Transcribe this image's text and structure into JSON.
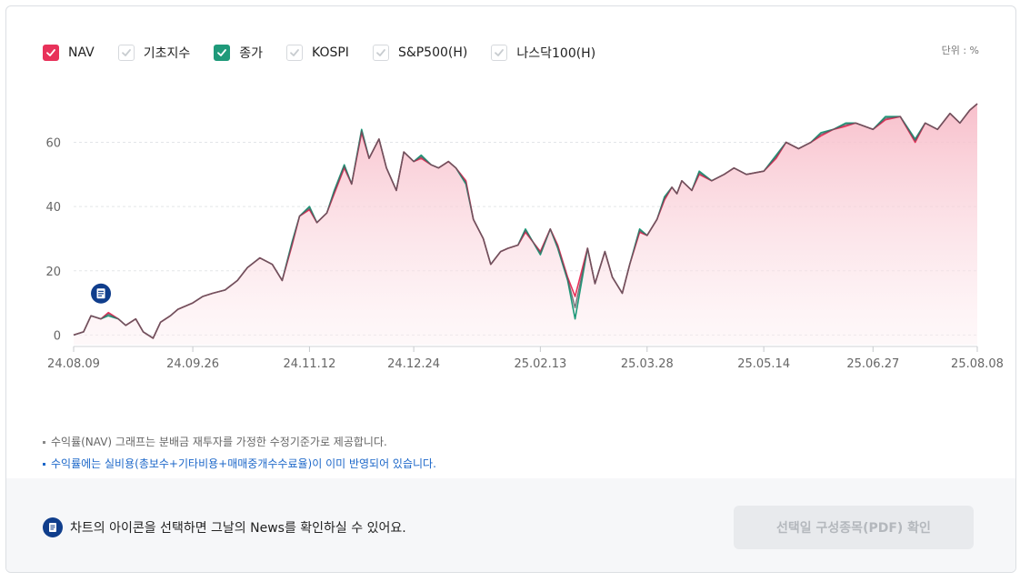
{
  "legend": {
    "items": [
      {
        "key": "nav",
        "label": "NAV",
        "checked": true,
        "color": "#e8325a"
      },
      {
        "key": "index",
        "label": "기초지수",
        "checked": false,
        "color": "#cccccc"
      },
      {
        "key": "close",
        "label": "종가",
        "checked": true,
        "color": "#1f9a7a"
      },
      {
        "key": "kospi",
        "label": "KOSPI",
        "checked": false,
        "color": "#cccccc"
      },
      {
        "key": "sp500",
        "label": "S&P500(H)",
        "checked": false,
        "color": "#cccccc"
      },
      {
        "key": "nasdaq",
        "label": "나스닥100(H)",
        "checked": false,
        "color": "#cccccc"
      }
    ]
  },
  "unit_label": "단위 : %",
  "chart_data": {
    "type": "line",
    "title": "",
    "xlabel": "",
    "ylabel": "",
    "ylim": [
      -3,
      74
    ],
    "yticks": [
      0,
      20,
      40,
      60
    ],
    "xlim": [
      "24.08.09",
      "25.08.08"
    ],
    "xticks": [
      "24.08.09",
      "24.09.26",
      "24.11.12",
      "24.12.24",
      "25.02.13",
      "25.03.28",
      "25.05.14",
      "25.06.27",
      "25.08.08"
    ],
    "grid": true,
    "area_fill_series": "NAV",
    "series": [
      {
        "name": "NAV",
        "color": "#e8325a",
        "x": [
          "24.08.09",
          "24.08.13",
          "24.08.16",
          "24.08.20",
          "24.08.23",
          "24.08.27",
          "24.08.30",
          "24.09.03",
          "24.09.06",
          "24.09.10",
          "24.09.13",
          "24.09.17",
          "24.09.20",
          "24.09.26",
          "24.09.30",
          "24.10.04",
          "24.10.09",
          "24.10.14",
          "24.10.18",
          "24.10.23",
          "24.10.28",
          "24.11.01",
          "24.11.05",
          "24.11.08",
          "24.11.12",
          "24.11.15",
          "24.11.19",
          "24.11.22",
          "24.11.26",
          "24.11.29",
          "24.12.03",
          "24.12.06",
          "24.12.10",
          "24.12.13",
          "24.12.17",
          "24.12.20",
          "24.12.24",
          "24.12.27",
          "24.12.31",
          "25.01.03",
          "25.01.07",
          "25.01.10",
          "25.01.14",
          "25.01.17",
          "25.01.21",
          "25.01.24",
          "25.01.28",
          "25.01.31",
          "25.02.04",
          "25.02.07",
          "25.02.13",
          "25.02.17",
          "25.02.20",
          "25.02.24",
          "25.02.27",
          "25.03.04",
          "25.03.07",
          "25.03.11",
          "25.03.14",
          "25.03.18",
          "25.03.21",
          "25.03.25",
          "25.03.28",
          "25.04.01",
          "25.04.04",
          "25.04.07",
          "25.04.09",
          "25.04.11",
          "25.04.15",
          "25.04.18",
          "25.04.23",
          "25.04.28",
          "25.05.02",
          "25.05.07",
          "25.05.14",
          "25.05.19",
          "25.05.23",
          "25.05.28",
          "25.06.02",
          "25.06.06",
          "25.06.11",
          "25.06.16",
          "25.06.20",
          "25.06.27",
          "25.07.02",
          "25.07.08",
          "25.07.14",
          "25.07.18",
          "25.07.23",
          "25.07.28",
          "25.08.01",
          "25.08.05",
          "25.08.08"
        ],
        "values": [
          0,
          1,
          6,
          5,
          7,
          5,
          3,
          5,
          1,
          -1,
          4,
          6,
          8,
          10,
          12,
          13,
          14,
          17,
          21,
          24,
          22,
          17,
          28,
          37,
          39,
          35,
          38,
          44,
          52,
          47,
          63,
          55,
          61,
          52,
          45,
          57,
          54,
          55,
          53,
          52,
          54,
          52,
          48,
          36,
          30,
          22,
          26,
          27,
          28,
          32,
          26,
          33,
          28,
          18,
          12,
          27,
          16,
          26,
          18,
          13,
          22,
          32,
          31,
          36,
          42,
          46,
          44,
          48,
          45,
          50,
          48,
          50,
          52,
          50,
          51,
          55,
          60,
          58,
          60,
          62,
          64,
          65,
          66,
          64,
          67,
          68,
          60,
          66,
          64,
          69,
          66,
          70,
          72
        ]
      },
      {
        "name": "종가",
        "color": "#1f9a7a",
        "x": [
          "24.08.09",
          "24.08.13",
          "24.08.16",
          "24.08.20",
          "24.08.23",
          "24.08.27",
          "24.08.30",
          "24.09.03",
          "24.09.06",
          "24.09.10",
          "24.09.13",
          "24.09.17",
          "24.09.20",
          "24.09.26",
          "24.09.30",
          "24.10.04",
          "24.10.09",
          "24.10.14",
          "24.10.18",
          "24.10.23",
          "24.10.28",
          "24.11.01",
          "24.11.05",
          "24.11.08",
          "24.11.12",
          "24.11.15",
          "24.11.19",
          "24.11.22",
          "24.11.26",
          "24.11.29",
          "24.12.03",
          "24.12.06",
          "24.12.10",
          "24.12.13",
          "24.12.17",
          "24.12.20",
          "24.12.24",
          "24.12.27",
          "24.12.31",
          "25.01.03",
          "25.01.07",
          "25.01.10",
          "25.01.14",
          "25.01.17",
          "25.01.21",
          "25.01.24",
          "25.01.28",
          "25.01.31",
          "25.02.04",
          "25.02.07",
          "25.02.13",
          "25.02.17",
          "25.02.20",
          "25.02.24",
          "25.02.27",
          "25.03.04",
          "25.03.07",
          "25.03.11",
          "25.03.14",
          "25.03.18",
          "25.03.21",
          "25.03.25",
          "25.03.28",
          "25.04.01",
          "25.04.04",
          "25.04.07",
          "25.04.09",
          "25.04.11",
          "25.04.15",
          "25.04.18",
          "25.04.23",
          "25.04.28",
          "25.05.02",
          "25.05.07",
          "25.05.14",
          "25.05.19",
          "25.05.23",
          "25.05.28",
          "25.06.02",
          "25.06.06",
          "25.06.11",
          "25.06.16",
          "25.06.20",
          "25.06.27",
          "25.07.02",
          "25.07.08",
          "25.07.14",
          "25.07.18",
          "25.07.23",
          "25.07.28",
          "25.08.01",
          "25.08.05",
          "25.08.08"
        ],
        "values": [
          0,
          1,
          6,
          5,
          6,
          5,
          3,
          5,
          1,
          -1,
          4,
          6,
          8,
          10,
          12,
          13,
          14,
          17,
          21,
          24,
          22,
          17,
          29,
          37,
          40,
          35,
          38,
          45,
          53,
          47,
          64,
          55,
          61,
          52,
          45,
          57,
          54,
          56,
          53,
          52,
          54,
          52,
          47,
          36,
          30,
          22,
          26,
          27,
          28,
          33,
          25,
          33,
          27,
          17,
          5,
          27,
          16,
          26,
          18,
          13,
          22,
          33,
          31,
          36,
          43,
          46,
          44,
          48,
          45,
          51,
          48,
          50,
          52,
          50,
          51,
          56,
          60,
          58,
          60,
          63,
          64,
          66,
          66,
          64,
          68,
          68,
          61,
          66,
          64,
          69,
          66,
          70,
          72
        ]
      }
    ]
  },
  "notes": [
    "수익률(NAV) 그래프는 분배금 재투자를 가정한 수정기준가로 제공합니다.",
    "수익률에는 실비용(총보수+기타비용+매매중개수수료율)이 이미 반영되어 있습니다."
  ],
  "footer": {
    "info_text": "차트의 아이콘을 선택하면 그날의 News를 확인하실 수 있어요.",
    "button_label": "선택일 구성종목(PDF) 확인",
    "news_icon": "document-icon"
  },
  "news_marker_date": "24.08.20"
}
